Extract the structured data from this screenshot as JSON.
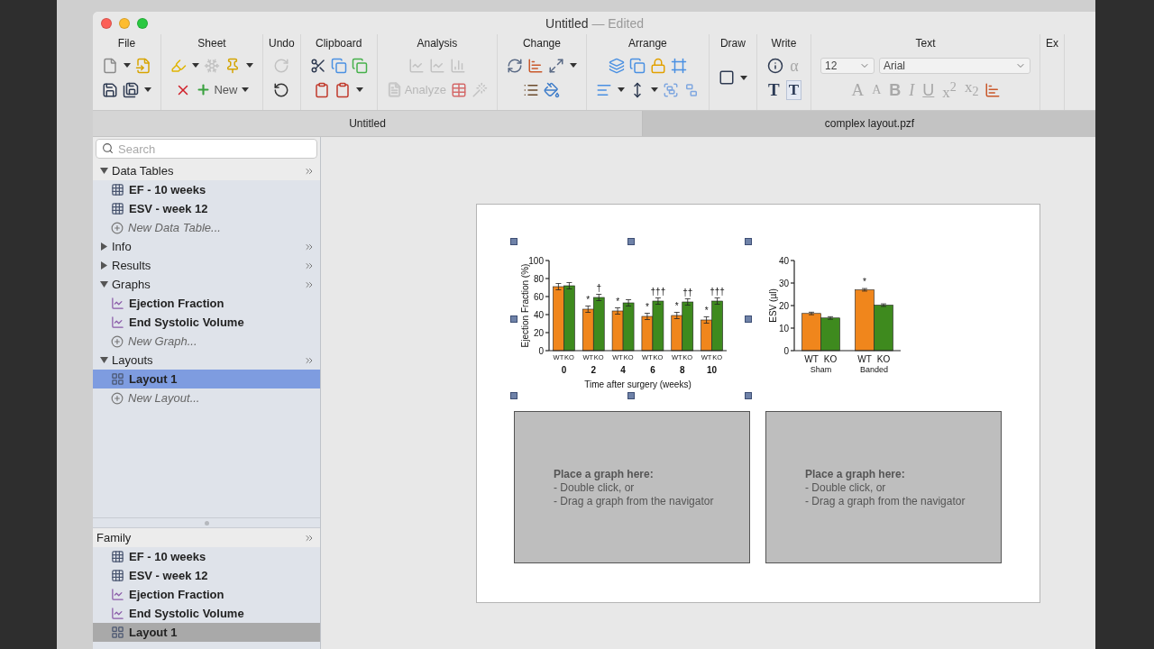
{
  "window": {
    "title": "Untitled",
    "status": "— Edited"
  },
  "toolbar": [
    {
      "label": "File",
      "top_row": [
        {
          "kind": "document",
          "dropdown": true,
          "disabled": false
        },
        {
          "kind": "import",
          "dropdown": false,
          "disabled": false
        }
      ],
      "bottom_row": [
        {
          "kind": "save",
          "dropdown": false,
          "disabled": false
        },
        {
          "kind": "save-all",
          "dropdown": true,
          "disabled": false
        }
      ]
    },
    {
      "label": "Sheet",
      "top_row": [
        {
          "kind": "highlighter",
          "dropdown": true,
          "disabled": false
        },
        {
          "kind": "snowflake",
          "dropdown": false,
          "disabled": true
        },
        {
          "kind": "pin",
          "dropdown": true,
          "disabled": false
        }
      ],
      "bottom_row": [
        {
          "kind": "delete",
          "dropdown": false,
          "disabled": false
        },
        {
          "kind": "new",
          "label": "New",
          "dropdown": true,
          "disabled": false
        }
      ]
    },
    {
      "label": "Undo",
      "top_row": [
        {
          "kind": "redo",
          "dropdown": false,
          "disabled": true
        }
      ],
      "bottom_row": [
        {
          "kind": "undo",
          "dropdown": false,
          "disabled": false
        }
      ]
    },
    {
      "label": "Clipboard",
      "top_row": [
        {
          "kind": "cut",
          "dropdown": false,
          "disabled": false
        },
        {
          "kind": "copy",
          "dropdown": false,
          "disabled": false
        },
        {
          "kind": "duplicate",
          "dropdown": false,
          "disabled": false
        }
      ],
      "bottom_row": [
        {
          "kind": "paste",
          "dropdown": false,
          "disabled": false
        },
        {
          "kind": "paste",
          "dropdown": true,
          "disabled": false
        }
      ]
    },
    {
      "label": "Analysis",
      "top_row": [
        {
          "kind": "line-chart",
          "dropdown": false,
          "disabled": true
        },
        {
          "kind": "line-chart",
          "dropdown": false,
          "disabled": true
        },
        {
          "kind": "column-chart",
          "dropdown": false,
          "disabled": true
        }
      ],
      "bottom_row": [
        {
          "kind": "analyze",
          "label": "Analyze",
          "dropdown": false,
          "disabled": true
        },
        {
          "kind": "table",
          "dropdown": false,
          "disabled": false
        },
        {
          "kind": "wand",
          "dropdown": false,
          "disabled": true
        }
      ]
    },
    {
      "label": "Change",
      "top_row": [
        {
          "kind": "refresh",
          "dropdown": false,
          "disabled": false
        },
        {
          "kind": "bar-chart",
          "dropdown": false,
          "disabled": false
        },
        {
          "kind": "resize",
          "dropdown": true,
          "disabled": false
        }
      ],
      "bottom_row": [
        {
          "kind": "list",
          "dropdown": false,
          "disabled": false
        },
        {
          "kind": "paint-bucket",
          "dropdown": false,
          "disabled": false
        }
      ]
    },
    {
      "label": "Arrange",
      "top_row": [
        {
          "kind": "layers",
          "dropdown": false,
          "disabled": false
        },
        {
          "kind": "copy",
          "dropdown": false,
          "disabled": false
        },
        {
          "kind": "lock",
          "dropdown": false,
          "disabled": false
        },
        {
          "kind": "frame",
          "dropdown": false,
          "disabled": false
        }
      ],
      "bottom_row": [
        {
          "kind": "align-left",
          "dropdown": true,
          "disabled": false
        },
        {
          "kind": "spacing",
          "dropdown": true,
          "disabled": false
        },
        {
          "kind": "group",
          "dropdown": false,
          "disabled": false
        },
        {
          "kind": "ungroup",
          "dropdown": false,
          "disabled": false
        }
      ]
    },
    {
      "label": "Draw",
      "top_row": [
        {
          "kind": "rectangle",
          "dropdown": true,
          "disabled": false
        }
      ]
    },
    {
      "label": "Write",
      "top_row": [
        {
          "kind": "info",
          "dropdown": false,
          "disabled": false
        },
        {
          "kind": "alpha",
          "label": "α",
          "dropdown": false,
          "disabled": true
        }
      ],
      "bottom_row": [
        {
          "kind": "text-tool",
          "label": "T",
          "dropdown": false,
          "disabled": false
        },
        {
          "kind": "text-box",
          "label": "T",
          "dropdown": false,
          "disabled": false
        }
      ]
    },
    {
      "label": "Text",
      "top_row": [
        {
          "kind": "select",
          "value": "12",
          "dropdown": true,
          "disabled": false
        },
        {
          "kind": "font-select",
          "value": "Arial",
          "dropdown": true,
          "disabled": false
        }
      ],
      "bottom_row": [
        {
          "kind": "grow-font",
          "label": "A",
          "dropdown": false,
          "disabled": true
        },
        {
          "kind": "shrink-font",
          "label": "A",
          "dropdown": false,
          "disabled": true
        },
        {
          "kind": "bold",
          "label": "B",
          "dropdown": false,
          "disabled": true
        },
        {
          "kind": "italic",
          "label": "I",
          "dropdown": false,
          "disabled": true
        },
        {
          "kind": "underline",
          "label": "U",
          "dropdown": false,
          "disabled": true
        },
        {
          "kind": "superscript",
          "label": "x$^{2}$",
          "dropdown": false,
          "disabled": true
        },
        {
          "kind": "subscript",
          "label": "x$_{2}$",
          "dropdown": false,
          "disabled": true
        },
        {
          "kind": "bar-chart",
          "dropdown": false,
          "disabled": false
        }
      ]
    },
    {
      "label": "Ex"
    }
  ],
  "tabs": [
    {
      "label": "Untitled",
      "selected": true
    },
    {
      "label": "complex layout.pzf",
      "selected": false
    }
  ],
  "sidebar": {
    "search": {
      "placeholder": "Search"
    },
    "sections": [
      {
        "title": "Data Tables",
        "expanded": true,
        "items": [
          {
            "kind": "table",
            "label": "EF - 10 weeks",
            "selected": false
          },
          {
            "kind": "table",
            "label": "ESV - week 12",
            "selected": false
          },
          {
            "kind": "new",
            "label": "New Data Table...",
            "selected": false
          }
        ]
      },
      {
        "title": "Info",
        "expanded": false
      },
      {
        "title": "Results",
        "expanded": false
      },
      {
        "title": "Graphs",
        "expanded": true,
        "items": [
          {
            "kind": "graph",
            "label": "Ejection Fraction",
            "selected": false
          },
          {
            "kind": "graph",
            "label": "End Systolic Volume",
            "selected": false
          },
          {
            "kind": "new",
            "label": "New Graph...",
            "selected": false
          }
        ]
      },
      {
        "title": "Layouts",
        "expanded": true,
        "items": [
          {
            "kind": "layout",
            "label": "Layout 1",
            "selected": true
          },
          {
            "kind": "new",
            "label": "New Layout...",
            "selected": false
          }
        ]
      }
    ],
    "family": {
      "title": "Family",
      "items": [
        {
          "kind": "table",
          "label": "EF - 10 weeks",
          "selected": false
        },
        {
          "kind": "table",
          "label": "ESV - week 12",
          "selected": false
        },
        {
          "kind": "graph",
          "label": "Ejection Fraction",
          "selected": false
        },
        {
          "kind": "graph",
          "label": "End Systolic Volume",
          "selected": false
        },
        {
          "kind": "layout",
          "label": "Layout 1",
          "selected": true
        }
      ]
    }
  },
  "layout": {
    "graphs": [
      {
        "selected": true,
        "chart_data": {
          "type": "bar",
          "xlabel": "Time after surgery (weeks)",
          "ylabel": "Ejection Fraction (%)",
          "categories": [
            "0",
            "2",
            "4",
            "6",
            "8",
            "10"
          ],
          "series": [
            {
              "name": "WT",
              "color": "#f0861c",
              "values": [
                71,
                46,
                44,
                38,
                39,
                34
              ]
            },
            {
              "name": "KO",
              "color": "#3e8a1e",
              "values": [
                72,
                59,
                53,
                55,
                54,
                55
              ]
            }
          ],
          "ylim": [
            0,
            100
          ],
          "yticks": [
            0,
            20,
            40,
            60,
            80,
            100
          ],
          "annotations": [
            {
              "x": "2",
              "y": 46,
              "text": "*"
            },
            {
              "x": "2",
              "y": 59,
              "text": "†"
            },
            {
              "x": "4",
              "y": 44,
              "text": "*"
            },
            {
              "x": "6",
              "y": 38,
              "text": "*"
            },
            {
              "x": "6",
              "y": 55,
              "text": "†††"
            },
            {
              "x": "8",
              "y": 39,
              "text": "*"
            },
            {
              "x": "8",
              "y": 54,
              "text": "††"
            },
            {
              "x": "10",
              "y": 34,
              "text": "*"
            },
            {
              "x": "10",
              "y": 55,
              "text": "†††"
            }
          ]
        }
      },
      {
        "selected": false,
        "chart_data": {
          "type": "bar",
          "ylabel": "ESV (µl)",
          "categories": [
            "Sham",
            "Banded"
          ],
          "series": [
            {
              "name": "WT",
              "color": "#f0861c",
              "values": [
                16.5,
                27
              ]
            },
            {
              "name": "KO",
              "color": "#3e8a1e",
              "values": [
                14.5,
                20.2
              ]
            }
          ],
          "ylim": [
            0,
            40
          ],
          "yticks": [
            0,
            10,
            20,
            30,
            40
          ],
          "annotations": [
            {
              "x": "Banded",
              "y": 27,
              "text": "*"
            }
          ]
        }
      }
    ],
    "placeholders": [
      {
        "title": "Place a graph here:",
        "lines": [
          "- Double click, or",
          "- Drag a graph from the navigator"
        ]
      },
      {
        "title": "Place a graph here:",
        "lines": [
          "- Double click, or",
          "- Drag a graph from the navigator"
        ]
      }
    ]
  }
}
